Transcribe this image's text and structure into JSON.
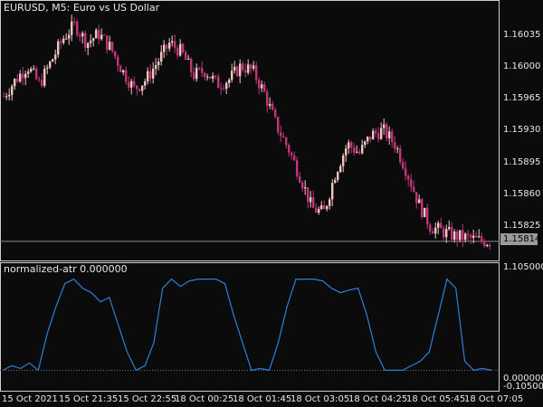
{
  "window": {
    "title": "EURUSD, M5:  Euro vs US Dollar"
  },
  "indicator": {
    "title": "normalized-atr 0.000000",
    "axis_labels": [
      "1.105000",
      "0.000000",
      "-0.105000"
    ]
  },
  "price_axis": {
    "labels": [
      "1.16035",
      "1.16000",
      "1.15965",
      "1.15930",
      "1.15895",
      "1.15860",
      "1.15825"
    ],
    "current_price": "1.15814"
  },
  "time_axis": {
    "labels": [
      "15 Oct 2021",
      "15 Oct 21:35",
      "15 Oct 22:55",
      "18 Oct 00:25",
      "18 Oct 01:45",
      "18 Oct 03:05",
      "18 Oct 04:25",
      "18 Oct 05:45",
      "18 Oct 07:05"
    ]
  },
  "colors": {
    "bull_candle": "#f2c6c0",
    "bear_candle": "#c2357a",
    "wick": "#d9d9d9",
    "indicator_line": "#2f7fd8",
    "grid": "#cfcfcf"
  },
  "chart_data": [
    {
      "type": "candlestick",
      "symbol": "EURUSD",
      "timeframe": "M5",
      "ylim": [
        1.15805,
        1.16065
      ],
      "current_price": 1.15814,
      "close_trend": [
        1.15972,
        1.1599,
        1.16005,
        1.15985,
        1.1601,
        1.16035,
        1.1605,
        1.1603,
        1.1604,
        1.16025,
        1.16,
        1.1598,
        1.1599,
        1.1601,
        1.1603,
        1.1602,
        1.15995,
        1.16,
        1.15985,
        1.1599,
        1.16005,
        1.16,
        1.15975,
        1.1594,
        1.15915,
        1.15885,
        1.1585,
        1.15845,
        1.1589,
        1.1592,
        1.1591,
        1.1593,
        1.15935,
        1.1592,
        1.1589,
        1.15855,
        1.1583,
        1.15825,
        1.1582,
        1.15818,
        1.15815,
        1.15814
      ]
    },
    {
      "type": "line",
      "name": "normalized-atr",
      "ylim": [
        -0.105,
        1.105
      ],
      "values": [
        0.0,
        0.05,
        0.02,
        0.08,
        0.0,
        0.4,
        0.7,
        0.95,
        1.0,
        0.9,
        0.85,
        0.75,
        0.8,
        0.5,
        0.2,
        0.0,
        0.05,
        0.3,
        0.9,
        1.0,
        0.92,
        0.98,
        1.0,
        1.0,
        1.0,
        0.95,
        0.6,
        0.3,
        0.0,
        0.02,
        0.0,
        0.3,
        0.7,
        1.0,
        1.0,
        1.0,
        0.98,
        0.9,
        0.85,
        0.88,
        0.9,
        0.6,
        0.2,
        0.0,
        0.0,
        0.0,
        0.05,
        0.1,
        0.2,
        0.6,
        1.0,
        0.9,
        0.1,
        0.0,
        0.02,
        0.0
      ]
    }
  ]
}
